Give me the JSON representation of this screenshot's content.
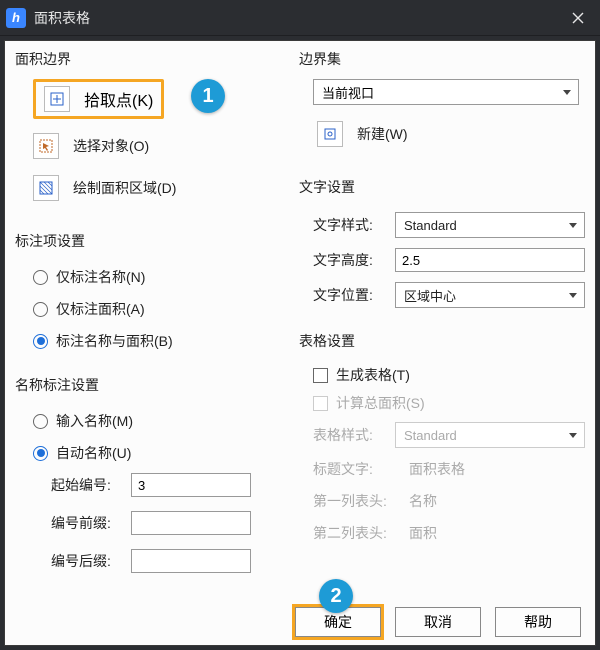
{
  "window": {
    "title": "面积表格"
  },
  "left": {
    "boundary": {
      "title": "面积边界",
      "pick_point": "拾取点(K)",
      "select_obj": "选择对象(O)",
      "draw_area": "绘制面积区域(D)"
    },
    "label_items": {
      "title": "标注项设置",
      "only_name": "仅标注名称(N)",
      "only_area": "仅标注面积(A)",
      "both": "标注名称与面积(B)"
    },
    "name_label": {
      "title": "名称标注设置",
      "input_name": "输入名称(M)",
      "auto_name": "自动名称(U)",
      "start_no_label": "起始编号:",
      "start_no_value": "3",
      "prefix_label": "编号前缀:",
      "prefix_value": "",
      "suffix_label": "编号后缀:",
      "suffix_value": ""
    }
  },
  "right": {
    "boundary_set": {
      "title": "边界集",
      "selected": "当前视口",
      "new_btn": "新建(W)"
    },
    "text_settings": {
      "title": "文字设置",
      "style_label": "文字样式:",
      "style_value": "Standard",
      "height_label": "文字高度:",
      "height_value": "2.5",
      "pos_label": "文字位置:",
      "pos_value": "区域中心"
    },
    "table_settings": {
      "title": "表格设置",
      "gen_table": "生成表格(T)",
      "calc_total": "计算总面积(S)",
      "style_label": "表格样式:",
      "style_value": "Standard",
      "title_label": "标题文字:",
      "title_value": "面积表格",
      "col1_label": "第一列表头:",
      "col1_value": "名称",
      "col2_label": "第二列表头:",
      "col2_value": "面积"
    }
  },
  "footer": {
    "ok": "确定",
    "cancel": "取消",
    "help": "帮助"
  },
  "callouts": {
    "one": "1",
    "two": "2"
  }
}
